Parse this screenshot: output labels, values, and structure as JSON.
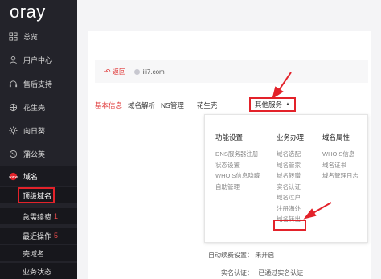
{
  "app": {
    "logo": "oray"
  },
  "sidebar": {
    "items": [
      {
        "label": "总览",
        "icon": "grid-icon"
      },
      {
        "label": "用户中心",
        "icon": "user-icon"
      },
      {
        "label": "售后支持",
        "icon": "headset-icon"
      },
      {
        "label": "花生壳",
        "icon": "peanut-icon"
      },
      {
        "label": "向日葵",
        "icon": "sunflower-icon"
      },
      {
        "label": "蒲公英",
        "icon": "dandelion-icon"
      },
      {
        "label": "域名",
        "icon": "domain-icon"
      }
    ],
    "sub_items": [
      {
        "label": "顶级域名",
        "count": ""
      },
      {
        "label": "急需续费",
        "count": "1"
      },
      {
        "label": "最近操作",
        "count": "5"
      },
      {
        "label": "壳域名",
        "count": ""
      },
      {
        "label": "业务状态",
        "count": ""
      }
    ]
  },
  "topbar": {
    "back_label": "返回",
    "domain": "iii7.com"
  },
  "tabs": [
    "基本信息",
    "域名解析",
    "NS管理",
    "花生壳"
  ],
  "tab_more": {
    "label": "其他服务"
  },
  "dropdown": {
    "columns": [
      {
        "title": "功能设置",
        "links": [
          "DNS服务器注册",
          "状态设置",
          "WHOIS信息隐藏",
          "自助管理"
        ]
      },
      {
        "title": "业务办理",
        "links": [
          "域名选配",
          "域名管家",
          "域名转赠",
          "实名认证",
          "域名过户",
          "注册海外",
          "域名转出"
        ]
      },
      {
        "title": "域名属性",
        "links": [
          "WHOIS信息",
          "域名证书",
          "域名管理日志"
        ]
      }
    ]
  },
  "info": {
    "auto_renew_label": "自动续费设置：",
    "auto_renew_value": "未开启",
    "realname_label": "实名认证：",
    "realname_value": "已通过实名认证"
  },
  "colors": {
    "sidebar_bg": "#23232a",
    "accent": "#e03c3c",
    "highlight": "#e3222a"
  }
}
